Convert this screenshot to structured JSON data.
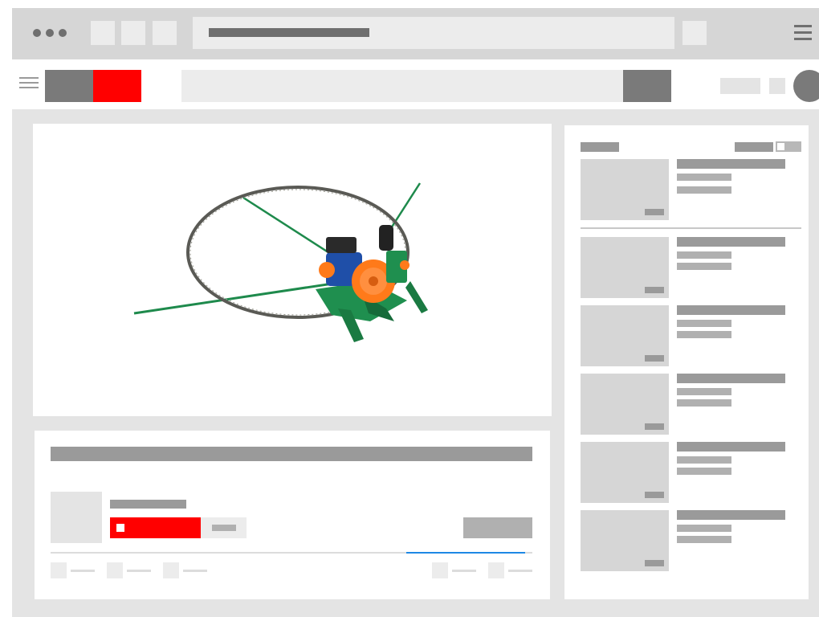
{
  "browser": {
    "window_controls": [
      "dot-icon",
      "dot-icon",
      "dot-icon"
    ],
    "tab_placeholders": 3,
    "menu_icon": "hamburger-icon"
  },
  "site_header": {
    "menu_icon": "hamburger-icon",
    "logo_colors": [
      "#7a7a7a",
      "#ff0000"
    ],
    "search_icon": "search-icon",
    "avatar_icon": "avatar-icon"
  },
  "video": {
    "subject": "band-saw-machine-illustration",
    "colors": {
      "frame": "#1e8a4c",
      "motor": "#1f4fa8",
      "wheel": "#ff7a1a",
      "blade": "#555555"
    }
  },
  "info_panel": {
    "subscribe_color": "#ff0000",
    "progress_color": "#1e88e5",
    "progress_fraction": 0.25,
    "stat_icons": [
      "like-icon",
      "dislike-icon",
      "share-icon",
      "save-icon",
      "more-icon"
    ]
  },
  "sidebar": {
    "autoplay_on": false,
    "items": [
      {
        "id": "up-next"
      },
      {
        "id": "video-2"
      },
      {
        "id": "video-3"
      },
      {
        "id": "video-4"
      },
      {
        "id": "video-5"
      },
      {
        "id": "video-6"
      }
    ]
  }
}
